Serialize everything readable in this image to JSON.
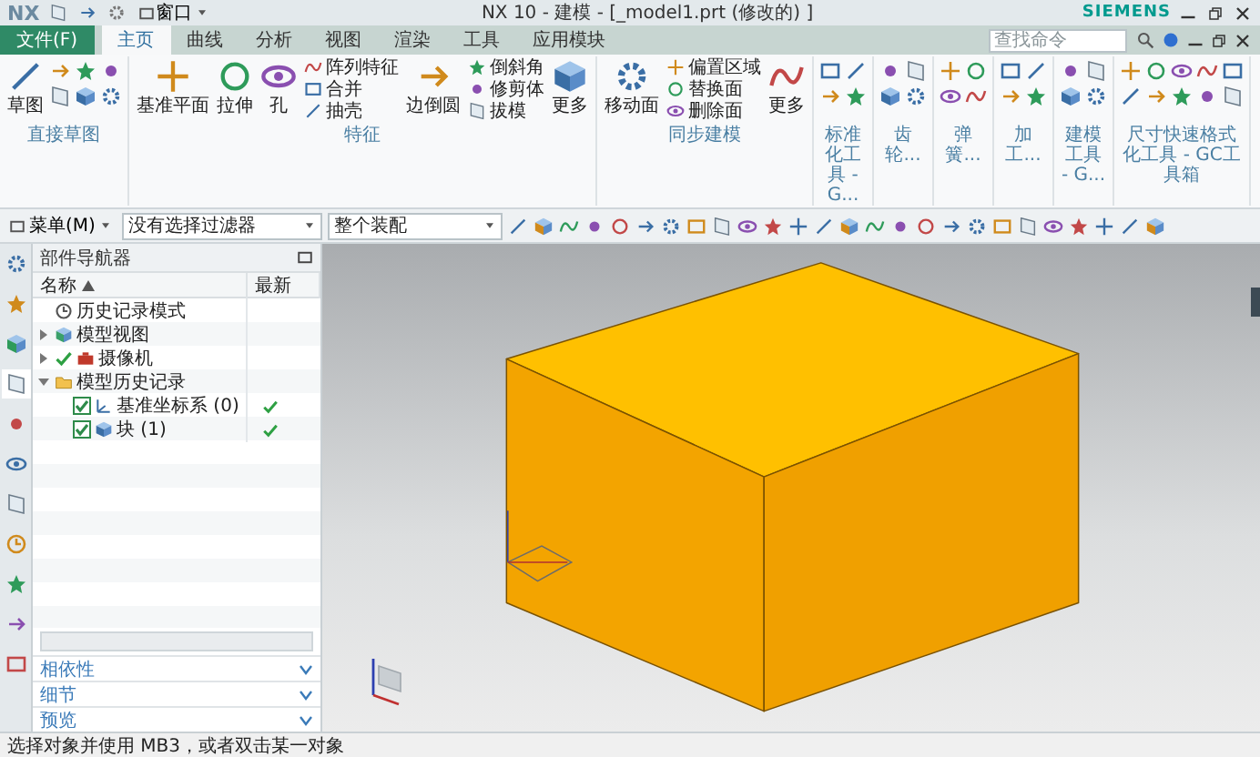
{
  "title_bar": {
    "app": "NX",
    "window_menu": "窗口",
    "title": "NX 10 - 建模 - [_model1.prt (修改的) ]",
    "brand": "SIEMENS"
  },
  "menu_tabs": [
    {
      "label": "文件(F)",
      "kind": "file",
      "selected": false
    },
    {
      "label": "主页",
      "kind": "tab",
      "selected": true
    },
    {
      "label": "曲线",
      "kind": "tab",
      "selected": false
    },
    {
      "label": "分析",
      "kind": "tab",
      "selected": false
    },
    {
      "label": "视图",
      "kind": "tab",
      "selected": false
    },
    {
      "label": "渲染",
      "kind": "tab",
      "selected": false
    },
    {
      "label": "工具",
      "kind": "tab",
      "selected": false
    },
    {
      "label": "应用模块",
      "kind": "tab",
      "selected": false
    }
  ],
  "search": {
    "placeholder": "查找命令"
  },
  "ribbon": [
    {
      "label": "直接草图",
      "items": [
        {
          "kind": "large",
          "label": "草图"
        },
        {
          "kind": "grid"
        }
      ]
    },
    {
      "label": "特征",
      "items": [
        {
          "kind": "large",
          "label": "基准平面"
        },
        {
          "kind": "large",
          "label": "拉伸"
        },
        {
          "kind": "large",
          "label": "孔"
        },
        {
          "kind": "column",
          "labels": [
            "阵列特征",
            "合并",
            "抽壳"
          ]
        },
        {
          "kind": "large",
          "label": "边倒圆"
        },
        {
          "kind": "column",
          "labels": [
            "倒斜角",
            "修剪体",
            "拔模"
          ]
        },
        {
          "kind": "large",
          "label": "更多"
        }
      ]
    },
    {
      "label": "同步建模",
      "items": [
        {
          "kind": "large",
          "label": "移动面"
        },
        {
          "kind": "column",
          "labels": [
            "偏置区域",
            "替换面",
            "删除面"
          ]
        },
        {
          "kind": "large",
          "label": "更多"
        }
      ]
    },
    {
      "label": "标准化工具 - G...",
      "items": [
        {
          "kind": "grid"
        }
      ]
    },
    {
      "label": "齿轮...",
      "items": [
        {
          "kind": "grid"
        }
      ]
    },
    {
      "label": "弹簧...",
      "items": [
        {
          "kind": "grid"
        }
      ]
    },
    {
      "label": "加工...",
      "items": [
        {
          "kind": "grid"
        }
      ]
    },
    {
      "label": "建模工具 - G...",
      "items": [
        {
          "kind": "grid"
        }
      ]
    },
    {
      "label": "尺寸快速格式化工具 - GC工具箱",
      "items": [
        {
          "kind": "grid"
        }
      ]
    }
  ],
  "toolbar": {
    "menu": "菜单(M)",
    "filter": "没有选择过滤器",
    "scope": "整个装配"
  },
  "resource_tabs": [
    {
      "selected": false
    },
    {
      "selected": false
    },
    {
      "selected": false
    },
    {
      "selected": true
    },
    {
      "selected": false
    },
    {
      "selected": false
    },
    {
      "selected": false
    },
    {
      "selected": false
    },
    {
      "selected": false
    },
    {
      "selected": false
    },
    {
      "selected": false
    }
  ],
  "navigator": {
    "title": "部件导航器",
    "columns": [
      "名称",
      "最新"
    ],
    "items": [
      {
        "label": "历史记录模式",
        "kind": "mode"
      },
      {
        "label": "模型视图",
        "kind": "view",
        "expanded": false
      },
      {
        "label": "摄像机",
        "kind": "camera",
        "expanded": false,
        "ticked": true
      },
      {
        "label": "模型历史记录",
        "kind": "folder",
        "expanded": true,
        "children": [
          {
            "label": "基准坐标系 (0)",
            "kind": "datum",
            "checked": true,
            "latest": true
          },
          {
            "label": "块 (1)",
            "kind": "body",
            "checked": true,
            "latest": true
          }
        ]
      }
    ]
  },
  "panels": [
    {
      "label": "相依性",
      "expanded": false
    },
    {
      "label": "细节",
      "expanded": false
    },
    {
      "label": "预览",
      "expanded": false
    }
  ],
  "status_bar": {
    "message": "选择对象并使用 MB3，或者双击某一对象"
  }
}
